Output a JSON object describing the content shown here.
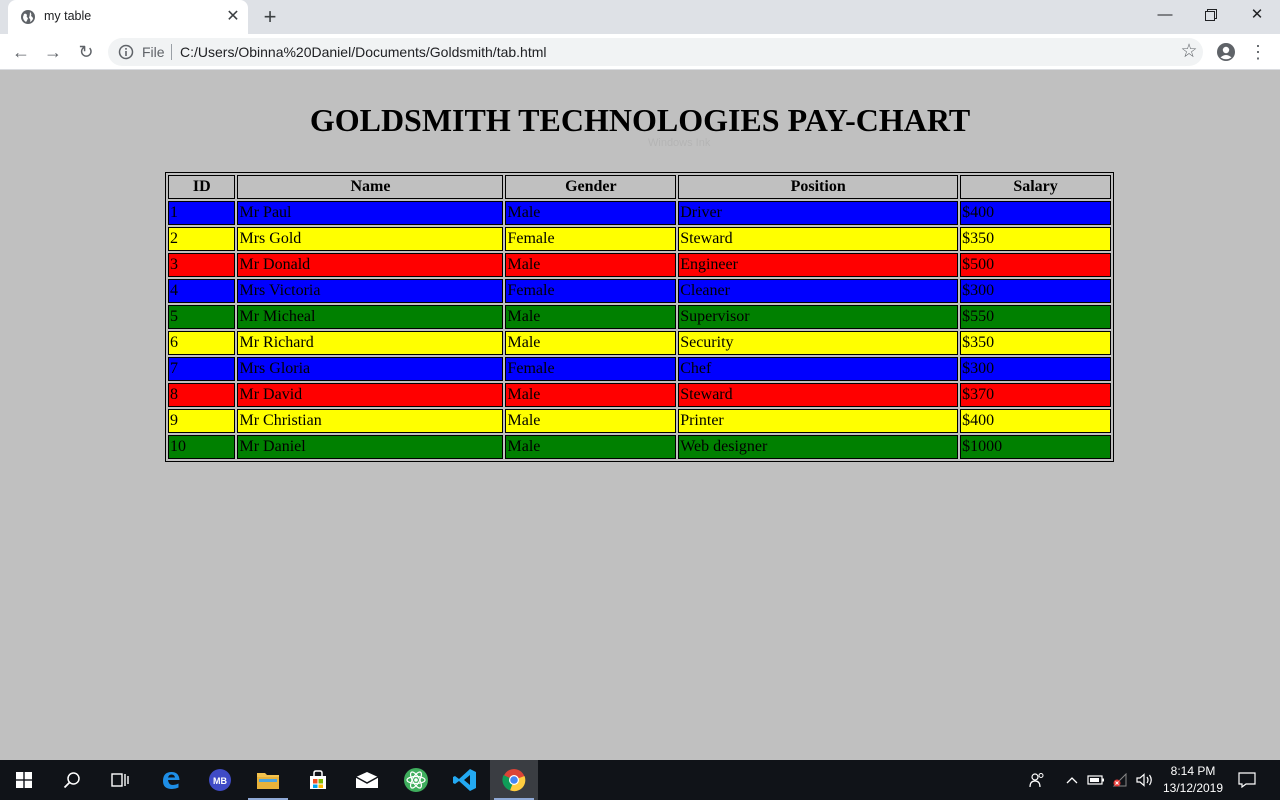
{
  "tab": {
    "title": "my table"
  },
  "address_bar": {
    "scheme_label": "File",
    "url": "C:/Users/Obinna%20Daniel/Documents/Goldsmith/tab.html"
  },
  "page": {
    "title": "GOLDSMITH TECHNOLOGIES PAY-CHART",
    "watermark": "Windows Ink"
  },
  "table": {
    "headers": [
      "ID",
      "Name",
      "Gender",
      "Position",
      "Salary"
    ],
    "rows": [
      {
        "id": "1",
        "name": "Mr Paul",
        "gender": "Male",
        "position": "Driver",
        "salary": "$400",
        "color": "#0000ff"
      },
      {
        "id": "2",
        "name": "Mrs Gold",
        "gender": "Female",
        "position": "Steward",
        "salary": "$350",
        "color": "#ffff00"
      },
      {
        "id": "3",
        "name": "Mr Donald",
        "gender": "Male",
        "position": "Engineer",
        "salary": "$500",
        "color": "#ff0000"
      },
      {
        "id": "4",
        "name": "Mrs Victoria",
        "gender": "Female",
        "position": "Cleaner",
        "salary": "$300",
        "color": "#0000ff"
      },
      {
        "id": "5",
        "name": "Mr Micheal",
        "gender": "Male",
        "position": "Supervisor",
        "salary": "$550",
        "color": "#008000"
      },
      {
        "id": "6",
        "name": "Mr Richard",
        "gender": "Male",
        "position": "Security",
        "salary": "$350",
        "color": "#ffff00"
      },
      {
        "id": "7",
        "name": "Mrs Gloria",
        "gender": "Female",
        "position": "Chef",
        "salary": "$300",
        "color": "#0000ff"
      },
      {
        "id": "8",
        "name": "Mr David",
        "gender": "Male",
        "position": "Steward",
        "salary": "$370",
        "color": "#ff0000"
      },
      {
        "id": "9",
        "name": "Mr Christian",
        "gender": "Male",
        "position": "Printer",
        "salary": "$400",
        "color": "#ffff00"
      },
      {
        "id": "10",
        "name": "Mr Daniel",
        "gender": "Male",
        "position": "Web designer",
        "salary": "$1000",
        "color": "#008000"
      }
    ]
  },
  "taskbar": {
    "items": [
      "start-icon",
      "search-icon",
      "task-view-icon",
      "edge-icon",
      "mb-app-icon",
      "file-explorer-icon",
      "store-icon",
      "mail-icon",
      "atom-icon",
      "vscode-icon",
      "chrome-icon"
    ],
    "mb_label": "MB",
    "time": "8:14 PM",
    "date": "13/12/2019"
  }
}
